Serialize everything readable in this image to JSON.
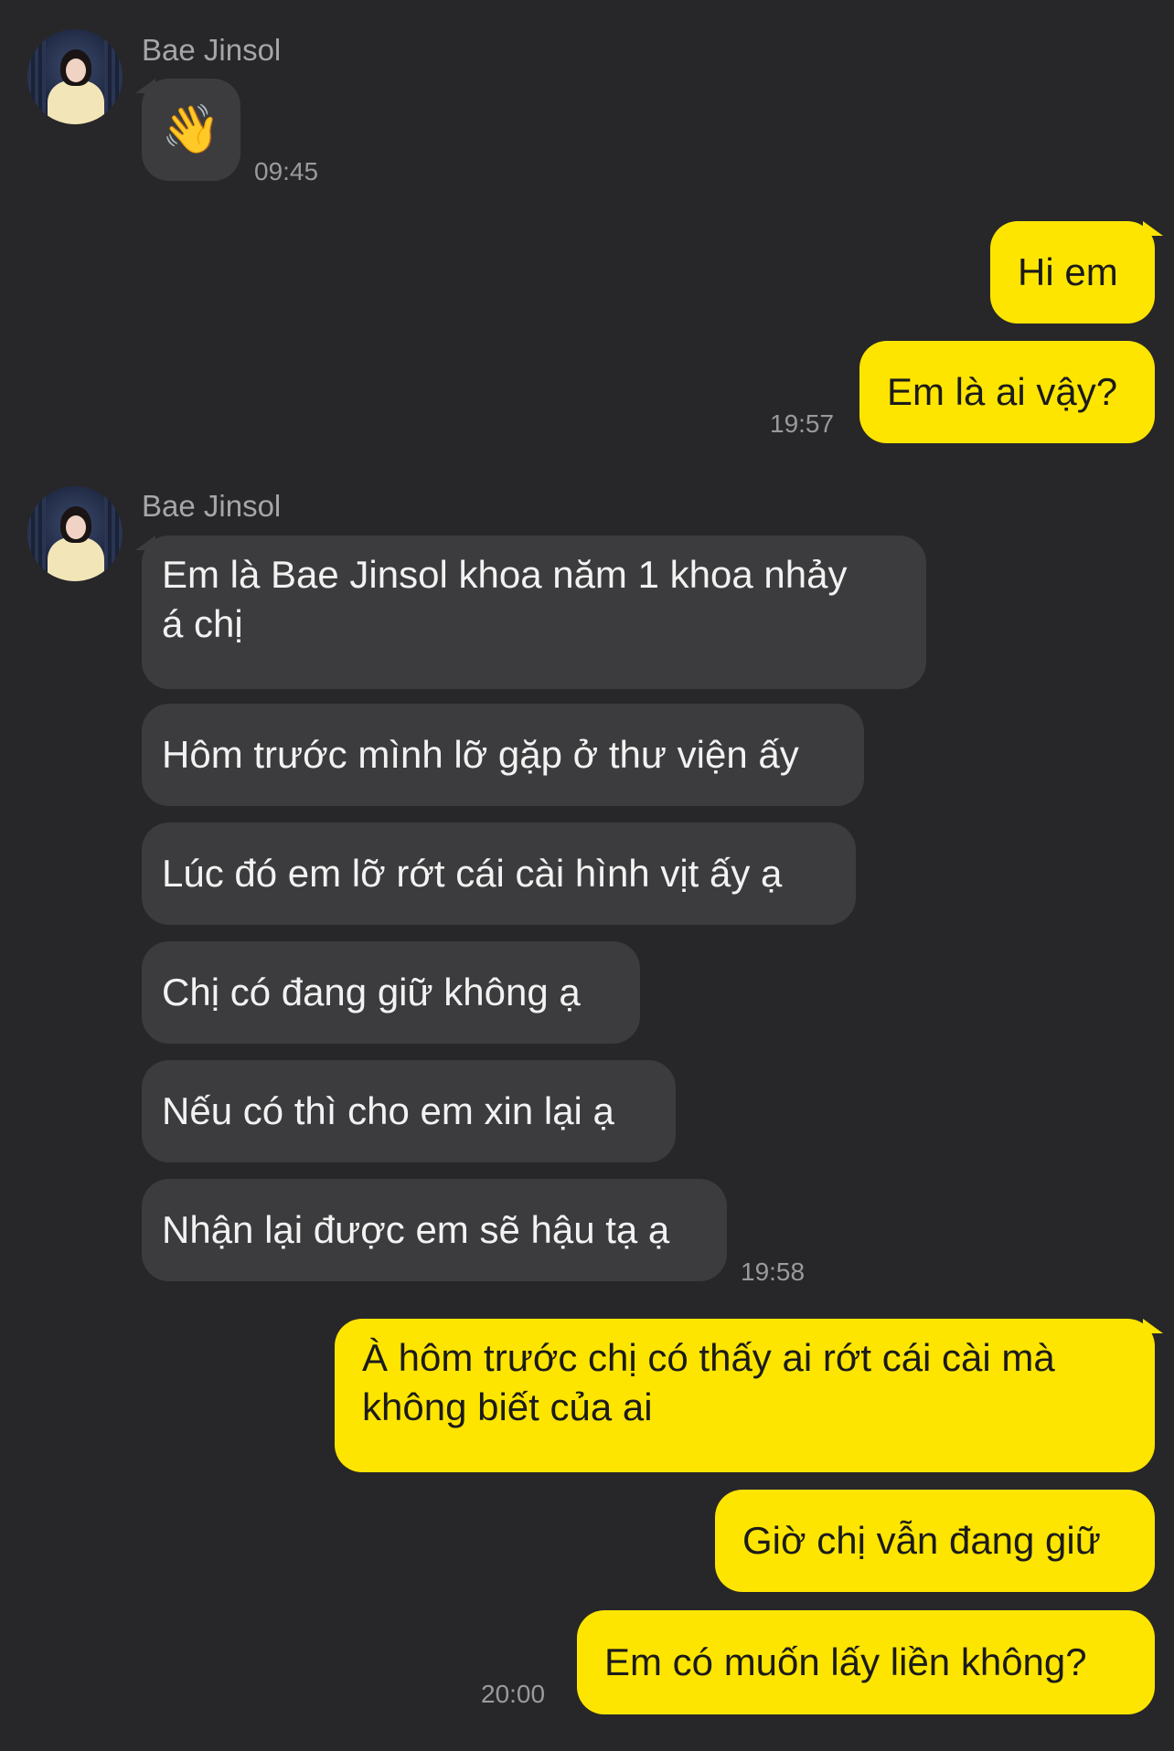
{
  "contact": {
    "name": "Bae Jinsol"
  },
  "messages": {
    "m1": {
      "text": "👋",
      "time": "09:45"
    },
    "m2": {
      "text": "Hi em"
    },
    "m3": {
      "text": "Em là ai vậy?",
      "time": "19:57"
    },
    "m4": {
      "line1": "Em là Bae Jinsol khoa năm 1 khoa nhảy",
      "line2": "á chị"
    },
    "m5": {
      "text": "Hôm trước mình lỡ gặp ở thư viện ấy"
    },
    "m6": {
      "text": "Lúc đó em lỡ rớt cái cài hình vịt ấy ạ"
    },
    "m7": {
      "text": "Chị có đang giữ không ạ"
    },
    "m8": {
      "text": "Nếu có thì cho em xin lại ạ"
    },
    "m9": {
      "text": "Nhận lại được em sẽ hậu tạ ạ",
      "time": "19:58"
    },
    "m10": {
      "line1": "À hôm trước chị có thấy ai rớt cái cài mà",
      "line2": "không biết của ai"
    },
    "m11": {
      "text": "Giờ chị vẫn đang giữ"
    },
    "m12": {
      "text": "Em có muốn lấy liền không?",
      "time": "20:00"
    }
  },
  "colors": {
    "background": "#272729",
    "incoming": "#3c3c3e",
    "outgoing": "#fee500"
  }
}
